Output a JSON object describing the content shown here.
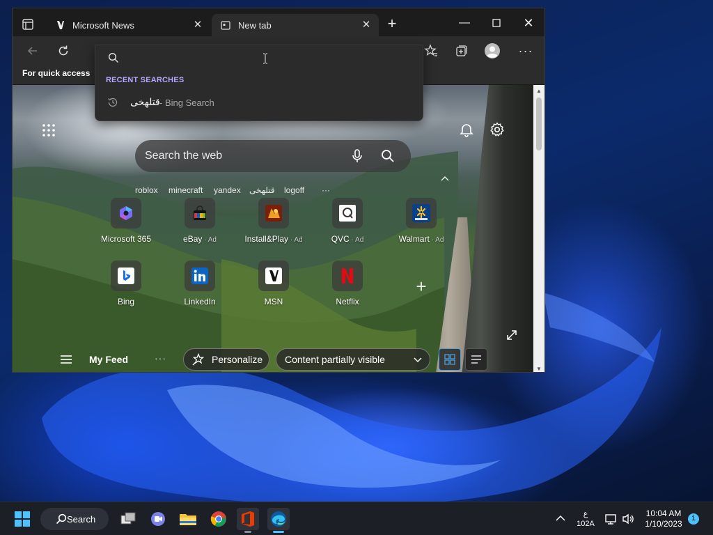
{
  "browser": {
    "tabs": [
      {
        "title": "Microsoft News"
      },
      {
        "title": "New tab"
      }
    ],
    "favorites_bar_text": "For quick access"
  },
  "address_dropdown": {
    "input_value": "",
    "recent_heading": "RECENT SEARCHES",
    "recent_items": [
      {
        "query": "قتلهخی",
        "source": " - Bing Search"
      }
    ]
  },
  "new_tab_page": {
    "search_placeholder": "Search the web",
    "trending": [
      "roblox",
      "minecraft",
      "yandex",
      "قتلهخی",
      "logoff"
    ],
    "trending_more": "···",
    "tiles_row1": [
      {
        "label": "Microsoft 365",
        "ad": ""
      },
      {
        "label": "eBay",
        "ad": " · Ad"
      },
      {
        "label": "Install&Play",
        "ad": " · Ad"
      },
      {
        "label": "QVC",
        "ad": " · Ad"
      },
      {
        "label": "Walmart",
        "ad": " · Ad"
      }
    ],
    "tiles_row2": [
      {
        "label": "Bing",
        "ad": ""
      },
      {
        "label": "LinkedIn",
        "ad": ""
      },
      {
        "label": "MSN",
        "ad": ""
      },
      {
        "label": "Netflix",
        "ad": ""
      }
    ],
    "feed": {
      "title": "My Feed",
      "more": "···",
      "personalize": "Personalize",
      "visibility": "Content partially visible"
    }
  },
  "taskbar": {
    "search_label": "Search",
    "lang_top": "ع",
    "lang_bottom": "102A",
    "time": "10:04 AM",
    "date": "1/10/2023",
    "notifications": "1"
  },
  "colors": {
    "accent": "#4cc2ff",
    "recent_heading": "#b5a8ff",
    "browser_bg": "#2c2c2c",
    "taskbar_bg": "#1c1f26"
  }
}
